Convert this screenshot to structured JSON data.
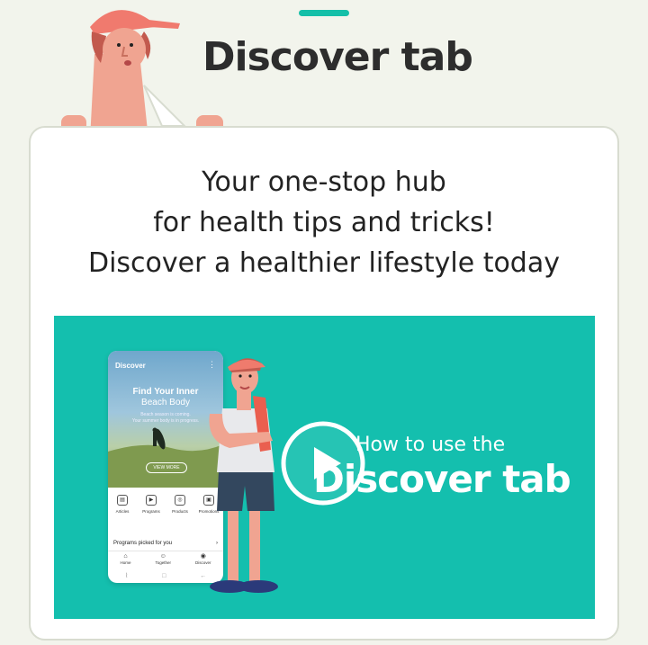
{
  "header": {
    "title": "Discover tab"
  },
  "intro": {
    "lines": [
      "Your one-stop hub",
      "for health tips and tricks!",
      "Discover a healthier lifestyle today"
    ]
  },
  "video": {
    "title_line1": "How to use the",
    "title_line2": "Discover tab",
    "phone": {
      "app_title": "Discover",
      "hero_title_1": "Find Your Inner",
      "hero_title_2": "Beach Body",
      "hero_sub_1": "Beach season is coming.",
      "hero_sub_2": "Your summer body is in progress.",
      "view_more": "VIEW MORE",
      "categories": [
        "Articles",
        "Programs",
        "Products",
        "Promotions"
      ],
      "programs_label": "Programs picked for you",
      "nav": [
        "Home",
        "Together",
        "Discover"
      ]
    }
  },
  "colors": {
    "accent": "#14bfae",
    "background": "#f2f4ec",
    "card": "#ffffff",
    "title": "#2d2d2d"
  }
}
